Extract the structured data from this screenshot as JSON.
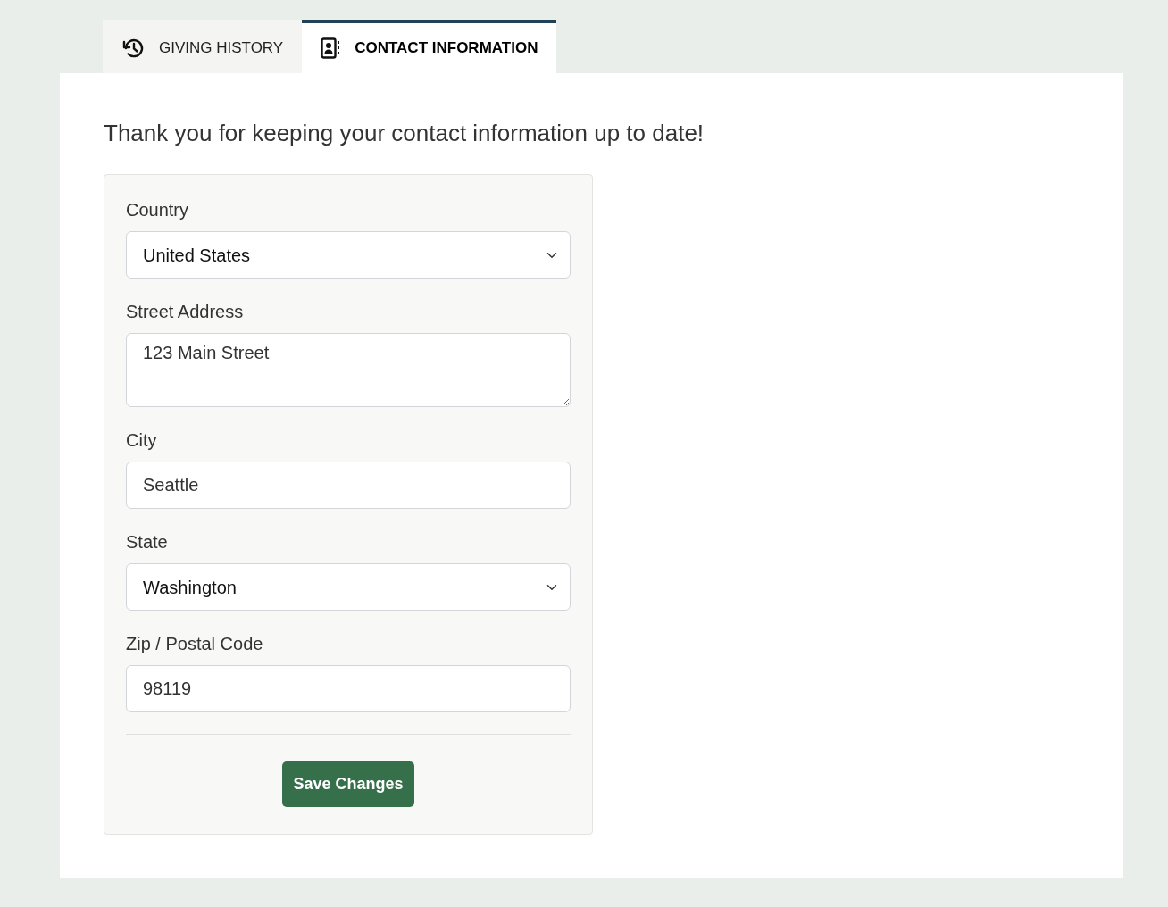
{
  "tabs": [
    {
      "label": "GIVING HISTORY",
      "selected": false
    },
    {
      "label": "CONTACT INFORMATION",
      "selected": true
    }
  ],
  "heading": "Thank you for keeping your contact information up to date!",
  "form": {
    "fields": [
      {
        "kind": "select",
        "label": "Country",
        "value": "United States"
      },
      {
        "kind": "textarea",
        "label": "Street Address",
        "value": "123 Main Street"
      },
      {
        "kind": "text",
        "label": "City",
        "value": "Seattle"
      },
      {
        "kind": "select",
        "label": "State",
        "value": "Washington"
      },
      {
        "kind": "text",
        "label": "Zip / Postal Code",
        "value": "98119"
      }
    ],
    "submit": "Save Changes"
  }
}
